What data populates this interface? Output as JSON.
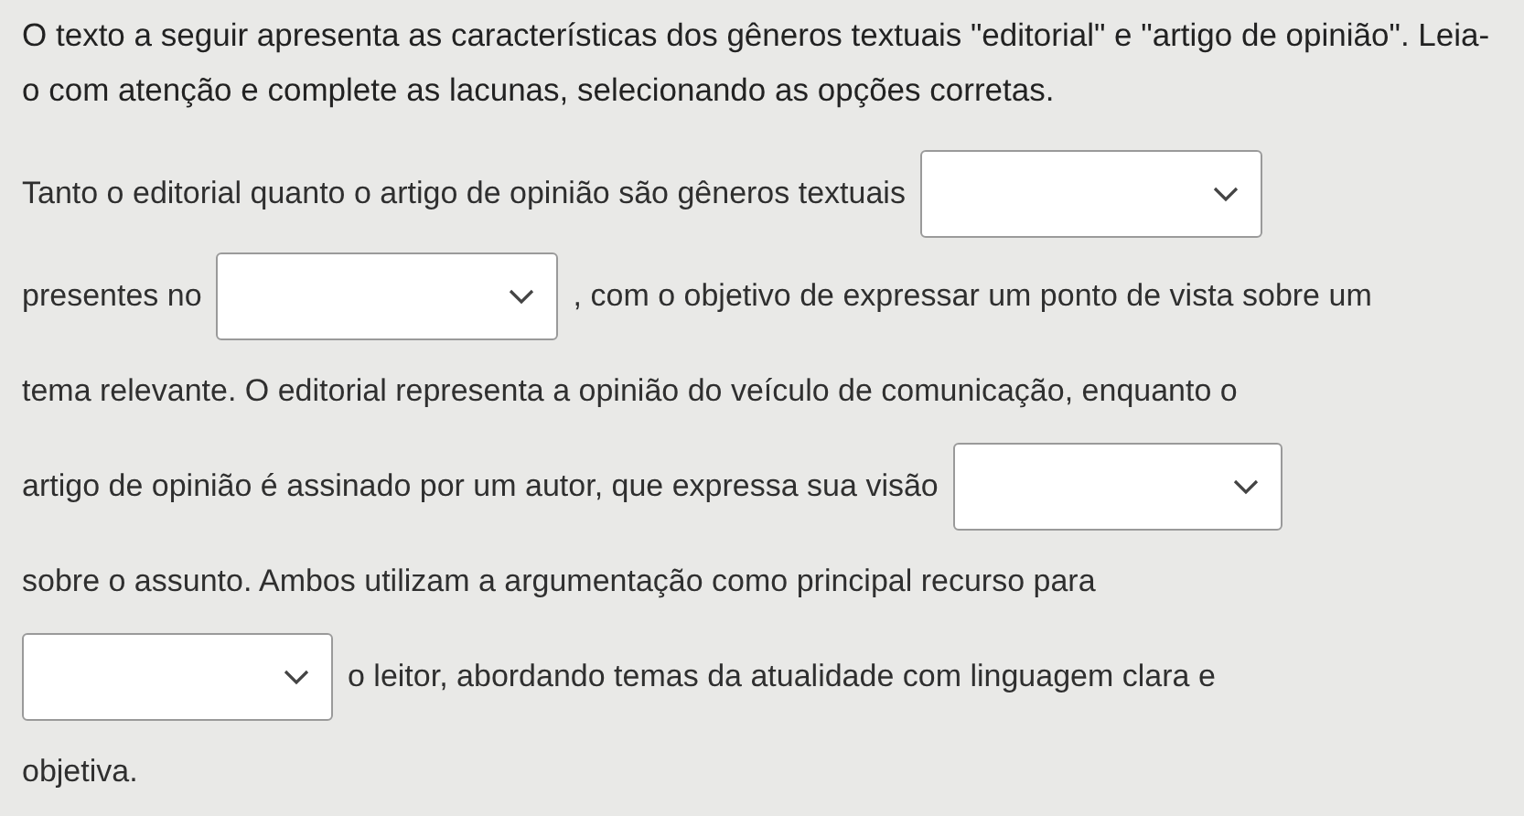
{
  "instructions": "O texto a seguir apresenta as características dos gêneros textuais \"editorial\" e \"artigo de opinião\". Leia-o com atenção e complete as lacunas, selecionando as opções corretas.",
  "passage_lines": [
    [
      {
        "kind": "text",
        "text": "Tanto o editorial quanto o artigo de opinião são gêneros textuais"
      },
      {
        "kind": "dropdown"
      }
    ],
    [
      {
        "kind": "text",
        "text": "presentes no"
      },
      {
        "kind": "dropdown"
      },
      {
        "kind": "text",
        "text": ", com o objetivo de expressar um ponto de vista sobre um"
      }
    ],
    [
      {
        "kind": "text",
        "text": "tema relevante. O editorial representa a opinião do veículo de comunicação, enquanto o"
      }
    ],
    [
      {
        "kind": "text",
        "text": "artigo de opinião é assinado por um autor, que expressa sua visão"
      },
      {
        "kind": "dropdown"
      }
    ],
    [
      {
        "kind": "text",
        "text": "sobre o assunto. Ambos utilizam a argumentação como principal recurso para"
      }
    ],
    [
      {
        "kind": "dropdown"
      },
      {
        "kind": "text",
        "text": "o leitor, abordando temas da atualidade com linguagem clara e"
      }
    ],
    [
      {
        "kind": "text",
        "text": "objetiva."
      }
    ]
  ]
}
